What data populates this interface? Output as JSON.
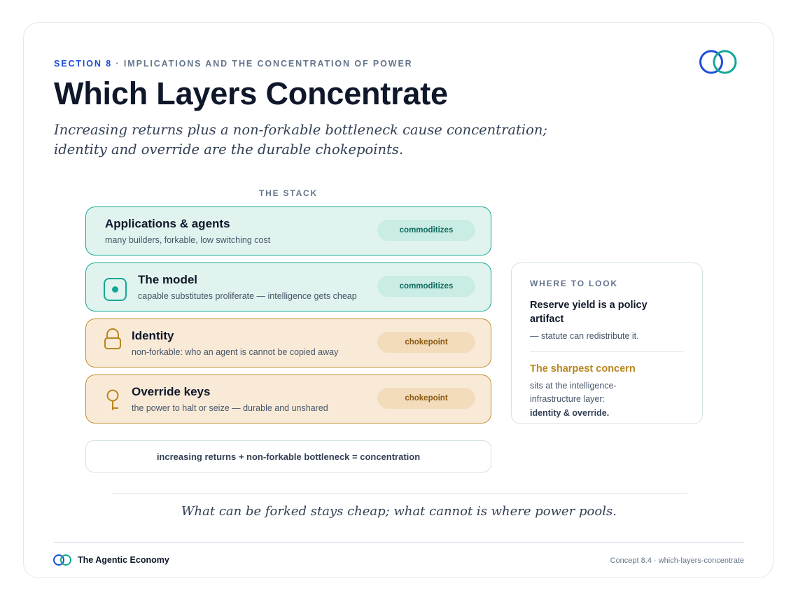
{
  "header": {
    "section_label": "SECTION 8",
    "section_title": "· IMPLICATIONS AND THE CONCENTRATION OF POWER",
    "title": "Which Layers Concentrate",
    "subtitle": "Increasing returns plus a non-forkable bottleneck cause concentration; identity and override are the durable chokepoints."
  },
  "stack": {
    "label": "THE STACK",
    "layers": [
      {
        "name": "Applications & agents",
        "description": "many builders, forkable, low switching cost",
        "tag": "commoditizes",
        "icon": null
      },
      {
        "name": "The model",
        "description": "capable substitutes proliferate — intelligence gets cheap",
        "tag": "commoditizes",
        "icon": "chip-icon"
      },
      {
        "name": "Identity",
        "description": "non-forkable: who an agent is cannot be copied away",
        "tag": "chokepoint",
        "icon": "lock-icon"
      },
      {
        "name": "Override keys",
        "description": "the power to halt or seize — durable and unshared",
        "tag": "chokepoint",
        "icon": "key-icon"
      }
    ],
    "formula": "increasing returns + non-forkable bottleneck = concentration"
  },
  "where_to_look": {
    "label": "WHERE TO LOOK",
    "heading1": "Reserve yield is a policy artifact",
    "text1": "— statute can redistribute it.",
    "heading2": "The sharpest concern",
    "text2": "sits at the intelligence-infrastructure layer:",
    "text3": "identity & override."
  },
  "quote": "What can be forked stays cheap; what cannot is where power pools.",
  "footer": {
    "brand": "The Agentic Economy",
    "reference": "Concept 8.4 · which-layers-concentrate"
  },
  "colors": {
    "accent_blue": "#1d4ed8",
    "accent_teal": "#14a795",
    "commoditizes_fill": "#e0f3ee",
    "chokepoint_fill": "#f8ead7",
    "chokepoint_border": "#c08a2a",
    "sharpest_concern": "#b8861f"
  }
}
